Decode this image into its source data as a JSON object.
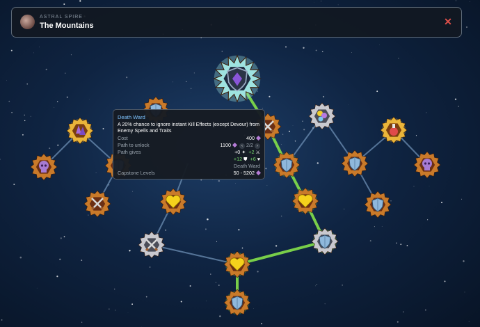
{
  "header": {
    "subtitle": "ASTRAL SPIRE",
    "title": "The Mountains",
    "close_icon": "close-icon",
    "close_color": "#e0504a"
  },
  "tooltip": {
    "title": "Death Ward",
    "description": "A 20% chance to ignore instant Kill Effects (except Devour) from Enemy Spells and Traits",
    "cost_label": "Cost",
    "cost_value": "400",
    "path_unlock_label": "Path to unlock",
    "path_unlock_value": "1100",
    "page": "2/2",
    "path_gives_label": "Path gives",
    "gives_row1_a": "+0",
    "gives_row1_b": "+2",
    "gives_row2_a": "+12",
    "gives_row2_b": "+6",
    "gives_name": "Death Ward",
    "capstone_label": "Capstone Levels",
    "capstone_value": "50 - 5202"
  },
  "colors": {
    "path_active": "#7ed84a",
    "path_inactive": "#6d8fb4",
    "node_bronze": "#c97a2a",
    "node_gold": "#e9b53a",
    "node_capstone": "#9ee3e0"
  },
  "nodes": [
    {
      "id": "capstone",
      "icon": "shield-gem-icon",
      "state": "capstone"
    },
    {
      "id": "left-gold-gems",
      "icon": "purple-gem-cluster-icon",
      "state": "gold"
    },
    {
      "id": "left-skull",
      "icon": "purple-skull-icon",
      "state": "bronze"
    },
    {
      "id": "left-swords",
      "icon": "crossed-swords-icon",
      "state": "bronze"
    },
    {
      "id": "left-hidden",
      "icon": "shield-icon",
      "state": "bronze"
    },
    {
      "id": "left-top-hidden",
      "icon": "shield-icon",
      "state": "bronze"
    },
    {
      "id": "left-heart",
      "icon": "heart-icon",
      "state": "bronze"
    },
    {
      "id": "swords-silver",
      "icon": "crossed-swords-icon",
      "state": "silver"
    },
    {
      "id": "center-top",
      "icon": "crossed-swords-icon",
      "state": "bronze"
    },
    {
      "id": "center-shield",
      "icon": "shield-icon",
      "state": "active"
    },
    {
      "id": "center-heart",
      "icon": "heart-icon",
      "state": "active"
    },
    {
      "id": "right-shield-low",
      "icon": "shield-icon",
      "state": "silver-active"
    },
    {
      "id": "bottom-heart",
      "icon": "heart-icon",
      "state": "active"
    },
    {
      "id": "bottom-shield",
      "icon": "shield-icon",
      "state": "active"
    },
    {
      "id": "right-gems-silver",
      "icon": "gem-cluster-icon",
      "state": "silver"
    },
    {
      "id": "right-shield",
      "icon": "shield-icon",
      "state": "bronze"
    },
    {
      "id": "right-shield-2",
      "icon": "shield-icon",
      "state": "bronze"
    },
    {
      "id": "right-potion",
      "icon": "potion-icon",
      "state": "gold"
    },
    {
      "id": "right-skull",
      "icon": "purple-skull-icon",
      "state": "bronze"
    }
  ]
}
